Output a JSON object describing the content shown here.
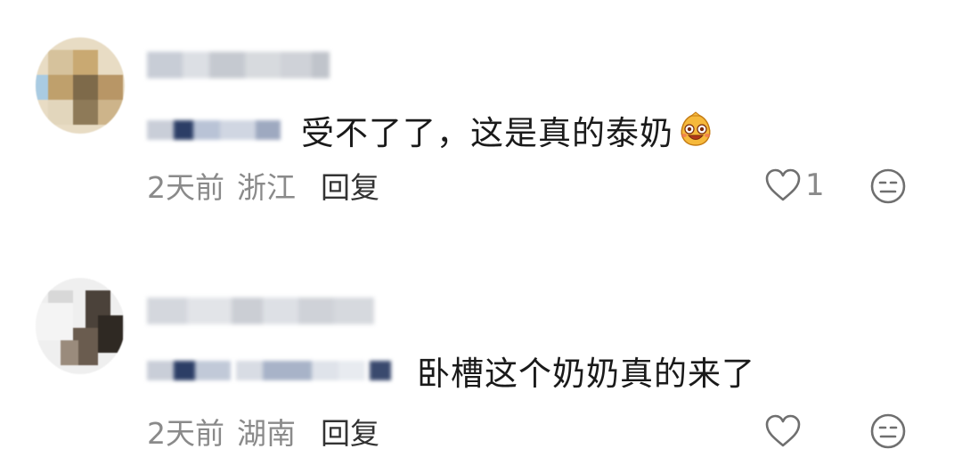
{
  "comments": [
    {
      "text": "受不了了，这是真的泰奶",
      "emoji_icon": "grinning-face-emoji-icon",
      "time": "2天前",
      "location": "浙江",
      "reply_label": "回复",
      "like_count": "1",
      "colors": {
        "avatar": [
          "#d9c9a8",
          "#b69a6c",
          "#8c7550",
          "#e9dfc9",
          "#9fc4e0"
        ]
      }
    },
    {
      "text": "卧槽这个奶奶真的来了",
      "time": "2天前",
      "location": "湖南",
      "reply_label": "回复",
      "like_count": "",
      "colors": {
        "avatar": [
          "#e3e3e3",
          "#3b342e",
          "#6d5f52",
          "#c8c8c8",
          "#f2f2f2"
        ]
      }
    }
  ],
  "icons": {
    "like": "heart-outline-icon",
    "dislike": "neutral-face-icon"
  }
}
